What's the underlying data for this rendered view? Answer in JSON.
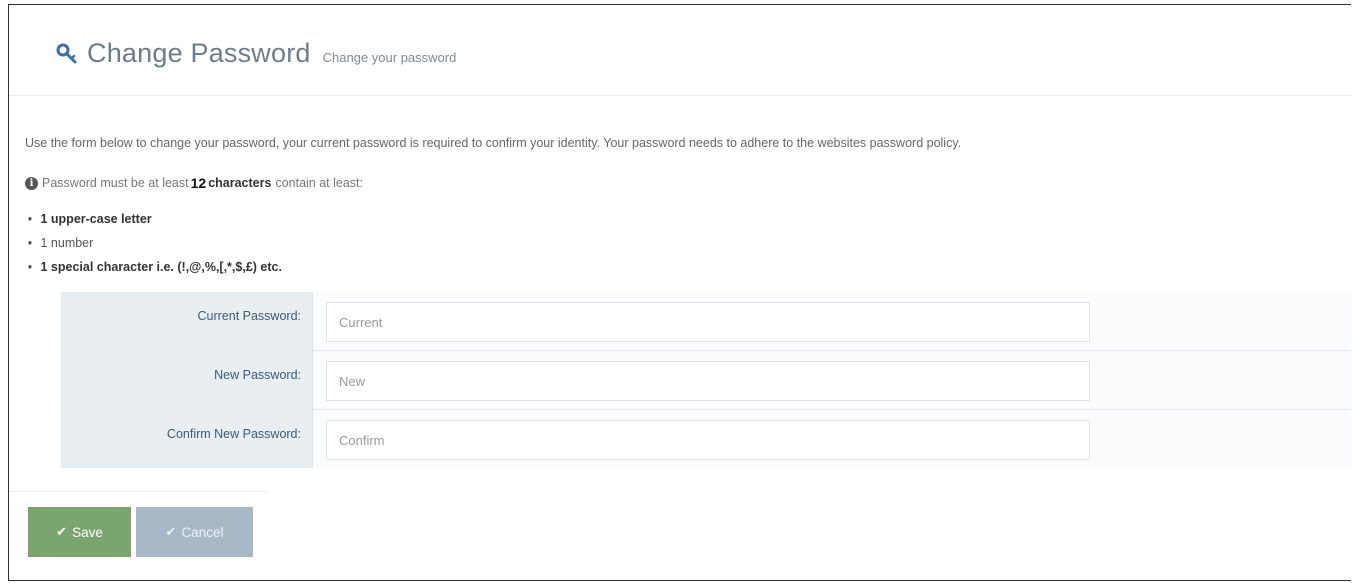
{
  "header": {
    "title": "Change Password",
    "subtitle": "Change your password"
  },
  "intro": "Use the form below to change your password, your current password is required to confirm your identity. Your password needs to adhere to the websites password policy.",
  "policy": {
    "prefix": "Password must be at least",
    "min_length": "12",
    "characters": "characters",
    "suffix": "contain at least:"
  },
  "rules": [
    "1 upper-case letter",
    "1 number",
    "1 special character i.e. (!,@,%,[,*,$,£) etc."
  ],
  "form": {
    "current": {
      "label": "Current Password:",
      "placeholder": "Current"
    },
    "new": {
      "label": "New Password:",
      "placeholder": "New"
    },
    "confirm": {
      "label": "Confirm New Password:",
      "placeholder": "Confirm"
    }
  },
  "actions": {
    "save_label": "Save",
    "cancel_label": "Cancel"
  },
  "colors": {
    "title": "#6e7d8c",
    "label_bg": "#e9eef2",
    "save": "#7aa56f",
    "cancel": "#a8b8c6"
  },
  "icons": [
    "key-icon",
    "info-icon",
    "check-icon"
  ]
}
